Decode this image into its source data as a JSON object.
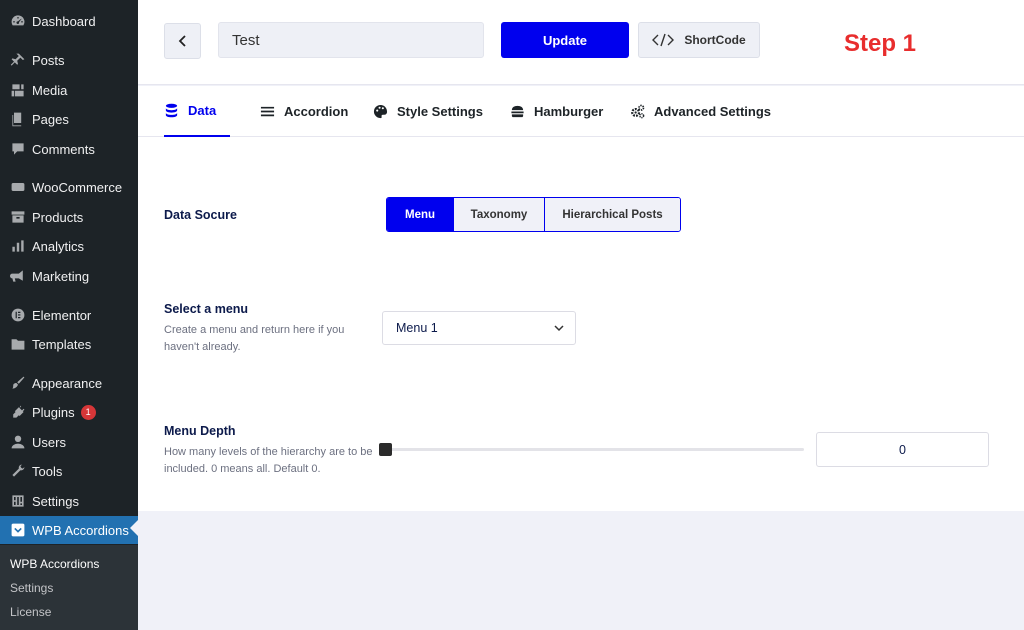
{
  "sidebar": {
    "items": [
      {
        "label": "Dashboard",
        "icon": "dashboard-icon"
      },
      {
        "label": "Posts",
        "icon": "pin-icon"
      },
      {
        "label": "Media",
        "icon": "media-icon"
      },
      {
        "label": "Pages",
        "icon": "pages-icon"
      },
      {
        "label": "Comments",
        "icon": "comment-icon"
      },
      {
        "label": "WooCommerce",
        "icon": "woocommerce-icon"
      },
      {
        "label": "Products",
        "icon": "archive-icon"
      },
      {
        "label": "Analytics",
        "icon": "bar-chart-icon"
      },
      {
        "label": "Marketing",
        "icon": "megaphone-icon"
      },
      {
        "label": "Elementor",
        "icon": "elementor-icon"
      },
      {
        "label": "Templates",
        "icon": "folder-icon"
      },
      {
        "label": "Appearance",
        "icon": "brush-icon"
      },
      {
        "label": "Plugins",
        "icon": "plugin-icon",
        "badge": "1"
      },
      {
        "label": "Users",
        "icon": "user-icon"
      },
      {
        "label": "Tools",
        "icon": "wrench-icon"
      },
      {
        "label": "Settings",
        "icon": "settings-icon"
      },
      {
        "label": "WPB Accordions",
        "icon": "chevron-box-icon"
      }
    ],
    "submenu": [
      "WPB Accordions",
      "Settings",
      "License"
    ],
    "active_color": "#2271b1"
  },
  "header": {
    "title_value": "Test",
    "update_label": "Update",
    "shortcode_label": "ShortCode",
    "step_label": "Step 1",
    "accent_color": "#0000ee",
    "step_color": "#e82d2d"
  },
  "tabs": [
    {
      "label": "Data",
      "icon": "database-icon"
    },
    {
      "label": "Accordion",
      "icon": "list-icon"
    },
    {
      "label": "Style Settings",
      "icon": "palette-icon"
    },
    {
      "label": "Hamburger",
      "icon": "hamburger-icon"
    },
    {
      "label": "Advanced Settings",
      "icon": "gears-icon"
    }
  ],
  "form": {
    "data_source": {
      "label": "Data Socure",
      "options": [
        "Menu",
        "Taxonomy",
        "Hierarchical Posts"
      ],
      "selected": "Menu"
    },
    "select_menu": {
      "label": "Select a menu",
      "description": "Create a menu and return here if you haven't already.",
      "value": "Menu 1"
    },
    "menu_depth": {
      "label": "Menu Depth",
      "description": "How many levels of the hierarchy are to be included. 0 means all. Default 0.",
      "value": "0",
      "slider_fraction": 0
    }
  }
}
